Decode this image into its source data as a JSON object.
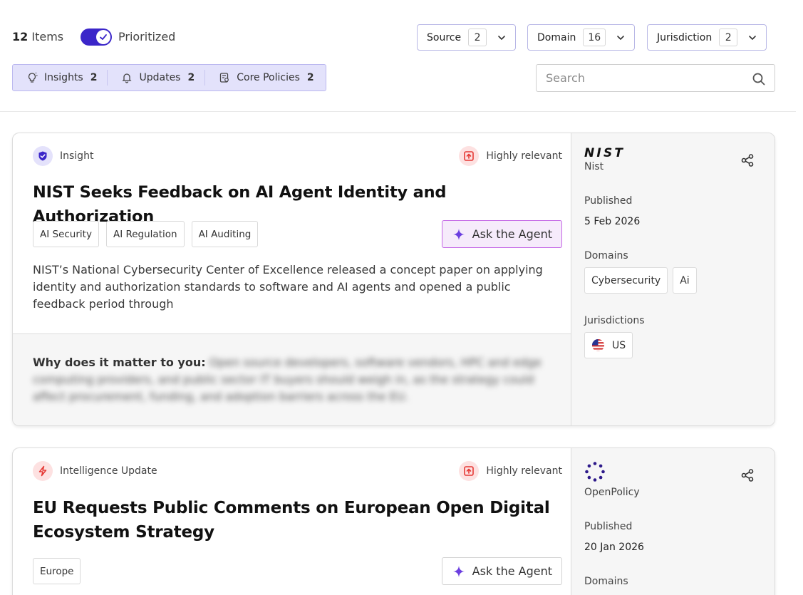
{
  "header": {
    "items_count": "12",
    "items_label": "Items",
    "prioritized_label": "Prioritized",
    "prioritized_on": true,
    "filters": [
      {
        "label": "Source",
        "count": "2"
      },
      {
        "label": "Domain",
        "count": "16"
      },
      {
        "label": "Jurisdiction",
        "count": "2"
      }
    ],
    "tabs": [
      {
        "label": "Insights",
        "count": "2",
        "icon": "lightbulb-icon"
      },
      {
        "label": "Updates",
        "count": "2",
        "icon": "bell-icon"
      },
      {
        "label": "Core Policies",
        "count": "2",
        "icon": "policy-doc-icon"
      }
    ],
    "search_placeholder": "Search"
  },
  "cards": [
    {
      "type": "Insight",
      "relevance": "Highly relevant",
      "title": "NIST Seeks Feedback on AI Agent Identity and Authorization",
      "tags": [
        "AI Security",
        "AI Regulation",
        "AI Auditing"
      ],
      "ask_label": "Ask the Agent",
      "description": "NIST’s National Cybersecurity Center of Excellence released a concept paper on applying identity and authorization standards to software and AI agents and opened a public feedback period through",
      "why_label": "Why does it matter to you:",
      "why_text": "Open source developers, software vendors, HPC and edge computing providers, and public sector IT buyers should weigh in, as the strategy could affect procurement, funding, and adoption barriers across the EU.",
      "source_logo_text": "NIST",
      "source_name": "Nist",
      "published_label": "Published",
      "published_date": "5 Feb 2026",
      "domains_label": "Domains",
      "domains": [
        "Cybersecurity",
        "Ai"
      ],
      "jurisdictions_label": "Jurisdictions",
      "jurisdictions": [
        "US"
      ]
    },
    {
      "type": "Intelligence Update",
      "relevance": "Highly relevant",
      "title_line1": "EU Requests Public Comments on European Open Digital",
      "title_line2": "Ecosystem Strategy",
      "tags": [
        "Europe"
      ],
      "ask_label": "Ask the Agent",
      "source_name": "OpenPolicy",
      "published_label": "Published",
      "published_date": "20 Jan 2026",
      "domains_label": "Domains"
    }
  ],
  "colors": {
    "accent": "#3b26c9",
    "tab_bg": "#e3e2fb",
    "relevance_red": "#e53935",
    "ask_star": "#6c3fe0"
  }
}
